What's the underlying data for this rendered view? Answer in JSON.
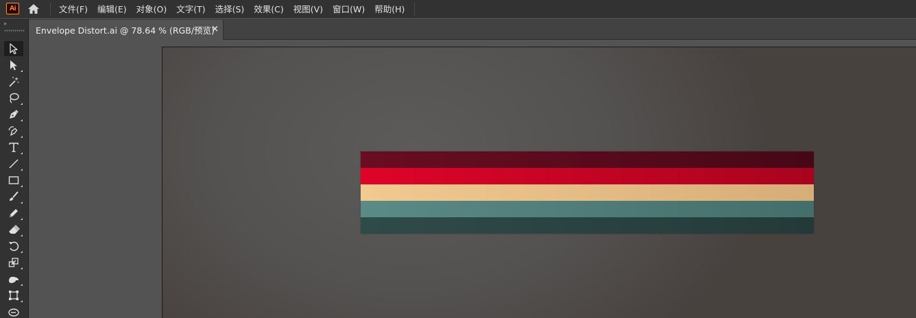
{
  "app": {
    "logo_text": "Ai"
  },
  "menu": {
    "items": [
      "文件(F)",
      "编辑(E)",
      "对象(O)",
      "文字(T)",
      "选择(S)",
      "效果(C)",
      "视图(V)",
      "窗口(W)",
      "帮助(H)"
    ]
  },
  "document": {
    "tab_title": "Envelope Distort.ai @ 78.64 % (RGB/预览)",
    "close_glyph": "×"
  },
  "toolbar": {
    "collapse_glyph": "»",
    "tools": [
      "selection-tool",
      "direct-selection-tool",
      "magic-wand-tool",
      "lasso-tool",
      "pen-tool",
      "curvature-tool",
      "type-tool",
      "line-tool",
      "rectangle-tool",
      "paintbrush-tool",
      "pencil-tool",
      "eraser-tool",
      "rotate-tool",
      "scale-tool",
      "width-tool",
      "free-transform-tool",
      "shape-builder-tool"
    ]
  },
  "artwork": {
    "stripe_colors": [
      {
        "from": "#6a0d22",
        "to": "#460816"
      },
      {
        "from": "#df0428",
        "to": "#a8041f"
      },
      {
        "from": "#f1ca90",
        "to": "#d6ad78"
      },
      {
        "from": "#5a8b86",
        "to": "#446e6a"
      },
      {
        "from": "#2f4b49",
        "to": "#243a39"
      }
    ]
  },
  "colors": {
    "ui_dark": "#323232",
    "canvas": "#535353",
    "accent_logo": "#ff9a00"
  }
}
